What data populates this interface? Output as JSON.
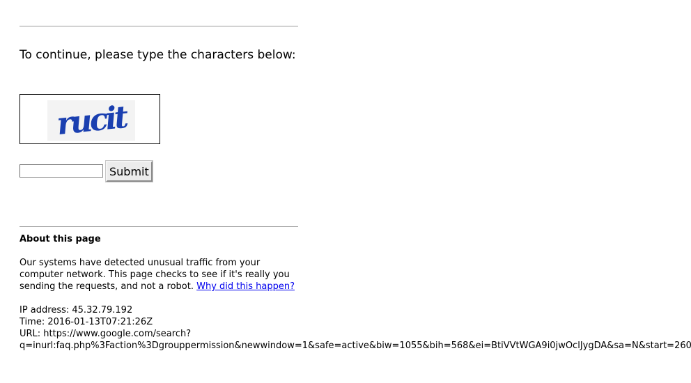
{
  "prompt": {
    "text": "To continue, please type the characters below:"
  },
  "captcha": {
    "image_text": "rucit",
    "image_color": "#1a3fb0",
    "input_value": ""
  },
  "form": {
    "submit_label": "Submit"
  },
  "about": {
    "title": "About this page",
    "body_text": "Our systems have detected unusual traffic from your computer network. This page checks to see if it's really you sending the requests, and not a robot.",
    "link_text": "Why did this happen?",
    "link_color": "#0000ee"
  },
  "meta": {
    "ip_line": "IP address: 45.32.79.192",
    "time_line": "Time: 2016-01-13T07:21:26Z",
    "url_line_1": "URL: https://www.google.com/search?",
    "url_line_2": "q=inurl:faq.php%3Faction%3Dgrouppermission&newwindow=1&safe=active&biw=1055&bih=568&ei=BtiVVtWGA9i0jwOclJygDA&sa=N&start=260"
  }
}
